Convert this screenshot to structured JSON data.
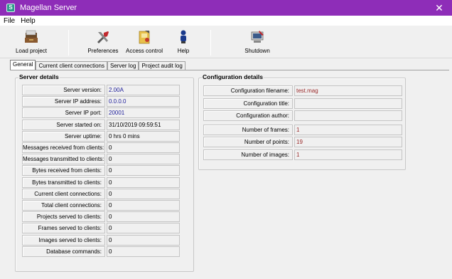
{
  "window": {
    "title": "Magellan Server",
    "app_icon_letter": "S",
    "close_glyph": "✕"
  },
  "menu": [
    "File",
    "Help"
  ],
  "toolbar": {
    "load_project": "Load project",
    "preferences": "Preferences",
    "access_control": "Access control",
    "help": "Help",
    "shutdown": "Shutdown"
  },
  "tabs": [
    "General",
    "Current client connections",
    "Server log",
    "Project audit log"
  ],
  "server_details": {
    "title": "Server details",
    "rows": [
      {
        "label": "Server version:",
        "value": "2.00A",
        "color": "blue"
      },
      {
        "label": "Server IP address:",
        "value": "0.0.0.0",
        "color": "blue"
      },
      {
        "label": "Server IP port:",
        "value": "20001",
        "color": "blue"
      },
      {
        "label": "Server started on:",
        "value": "31/10/2019 09:59:51",
        "color": "black"
      },
      {
        "label": "Server uptime:",
        "value": "0 hrs 0 mins",
        "color": "black"
      },
      {
        "label": "Messages received from clients:",
        "value": "0",
        "color": "black"
      },
      {
        "label": "Messages transmitted to clients:",
        "value": "0",
        "color": "black"
      },
      {
        "label": "Bytes received from clients:",
        "value": "0",
        "color": "black"
      },
      {
        "label": "Bytes transmitted to clients:",
        "value": "0",
        "color": "black"
      },
      {
        "label": "Current client connections:",
        "value": "0",
        "color": "black"
      },
      {
        "label": "Total client connections:",
        "value": "0",
        "color": "black"
      },
      {
        "label": "Projects served to clients:",
        "value": "0",
        "color": "black"
      },
      {
        "label": "Frames served to clients:",
        "value": "0",
        "color": "black"
      },
      {
        "label": "Images served to clients:",
        "value": "0",
        "color": "black"
      },
      {
        "label": "Database commands:",
        "value": "0",
        "color": "black"
      }
    ]
  },
  "configuration_details": {
    "title": "Configuration details",
    "rows": [
      {
        "label": "Configuration filename:",
        "value": "test.mag",
        "color": "red"
      },
      {
        "label": "Configuration title:",
        "value": "",
        "color": "black"
      },
      {
        "label": "Configuration author:",
        "value": "",
        "color": "black"
      },
      {
        "label": "Number of frames:",
        "value": "1",
        "color": "red"
      },
      {
        "label": "Number of points:",
        "value": "19",
        "color": "red"
      },
      {
        "label": "Number of images:",
        "value": "1",
        "color": "red"
      }
    ]
  },
  "colors": {
    "titlebar": "#8e2db8",
    "value_blue": "#1d1d9a",
    "value_red": "#9a2a2a"
  }
}
